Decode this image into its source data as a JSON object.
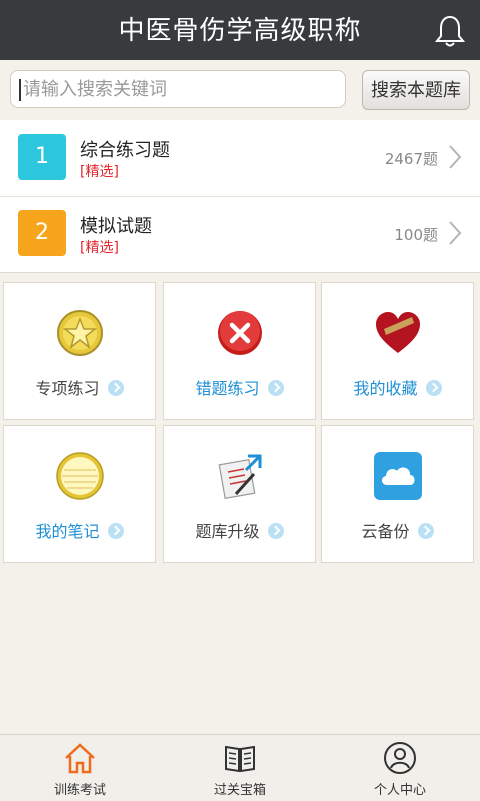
{
  "header": {
    "title": "中医骨伤学高级职称",
    "bell_icon": "bell-icon"
  },
  "search": {
    "placeholder": "请输入搜索关键词",
    "button_label": "搜索本题库"
  },
  "list": [
    {
      "number": "1",
      "title": "综合练习题",
      "tag": "[精选]",
      "count": "2467题",
      "color": "#2cc7dd"
    },
    {
      "number": "2",
      "title": "模拟试题",
      "tag": "[精选]",
      "count": "100题",
      "color": "#f7a51c"
    }
  ],
  "tiles": [
    {
      "label": "专项练习",
      "icon": "star-icon"
    },
    {
      "label": "错题练习",
      "icon": "wrong-icon"
    },
    {
      "label": "我的收藏",
      "icon": "heart-icon"
    },
    {
      "label": "我的笔记",
      "icon": "notebook-icon"
    },
    {
      "label": "题库升级",
      "icon": "upgrade-icon"
    },
    {
      "label": "云备份",
      "icon": "cloud-icon"
    }
  ],
  "tabs": [
    {
      "label": "训练考试",
      "icon": "home-icon",
      "active": true
    },
    {
      "label": "过关宝箱",
      "icon": "book-icon",
      "active": false
    },
    {
      "label": "个人中心",
      "icon": "user-icon",
      "active": false
    }
  ]
}
